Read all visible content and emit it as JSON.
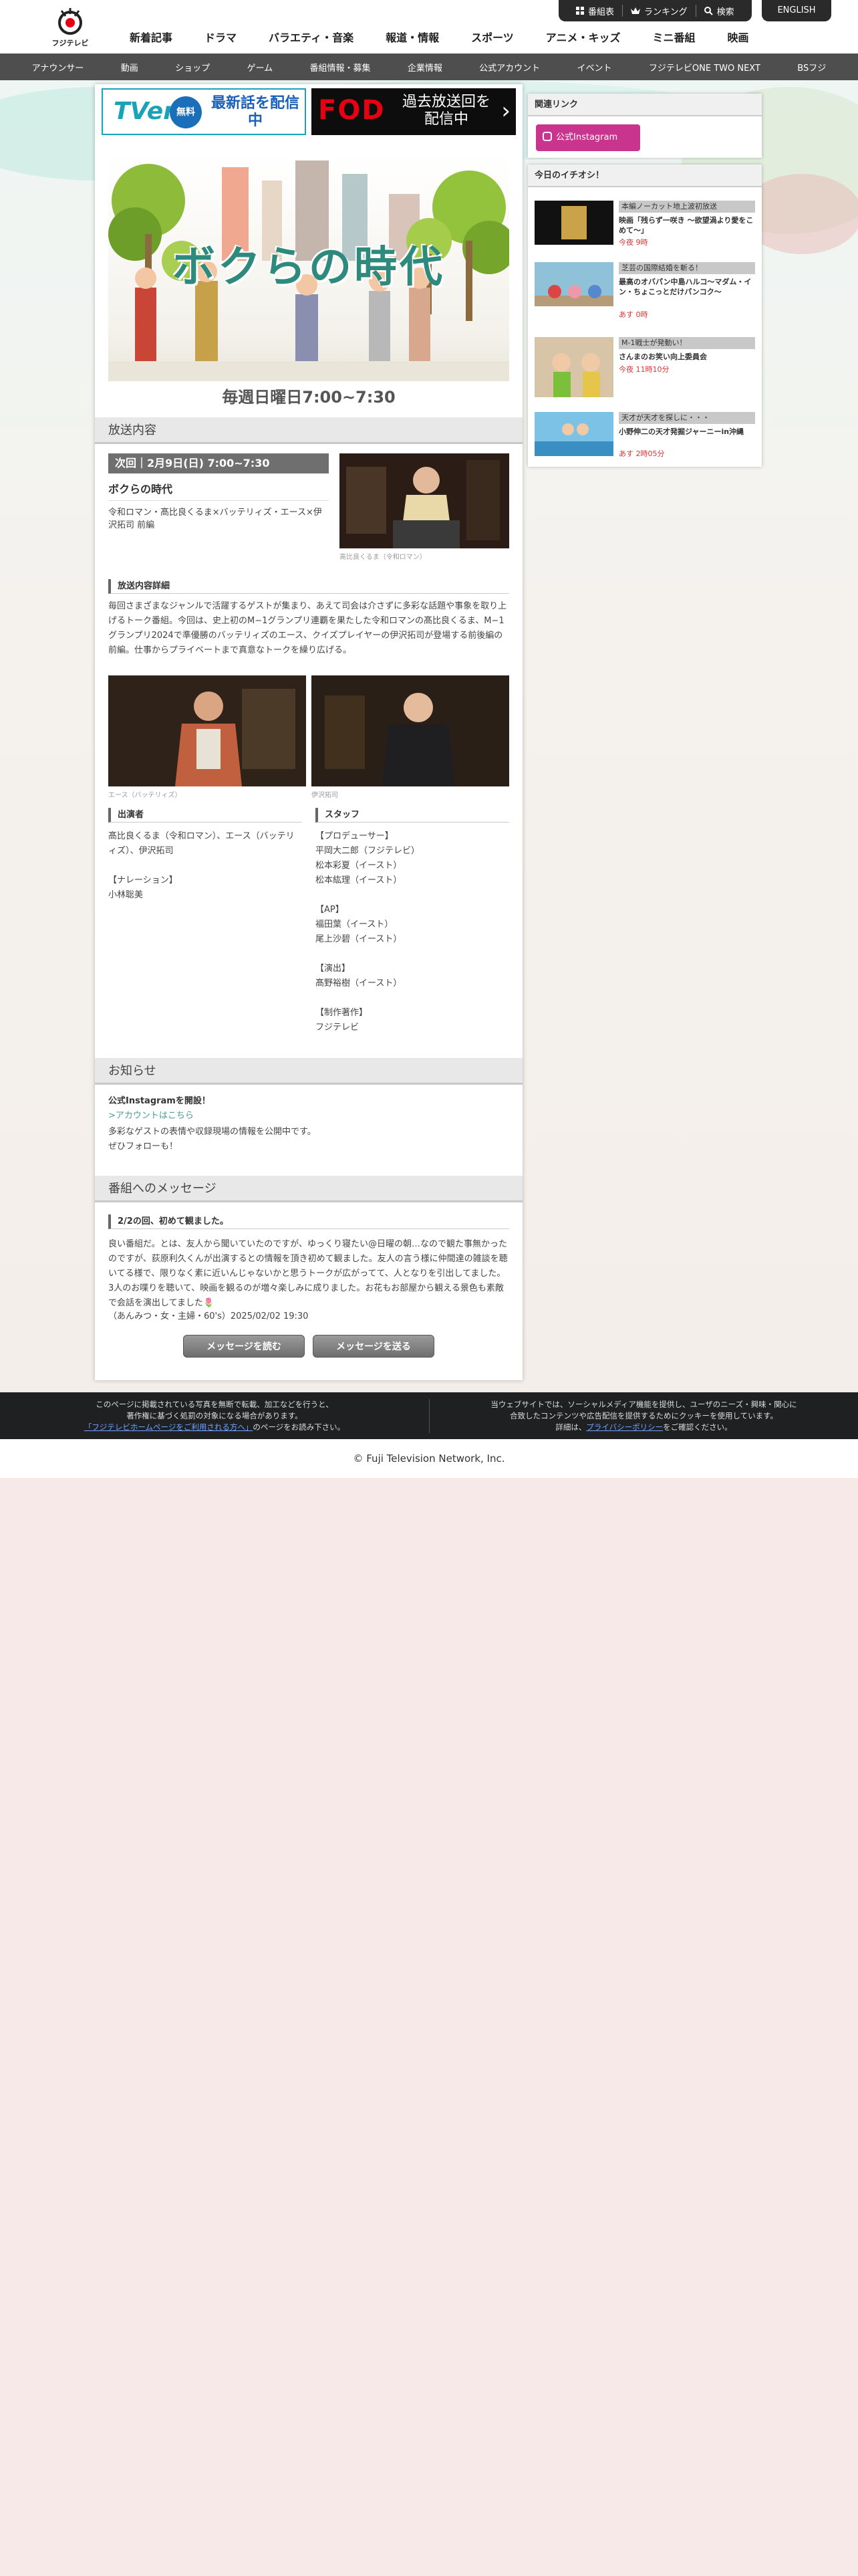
{
  "header": {
    "logo_text": "フジテレビ",
    "util": {
      "schedule": "番組表",
      "ranking": "ランキング",
      "search": "検索"
    },
    "english": "ENGLISH",
    "gnav": [
      "新着記事",
      "ドラマ",
      "バラエティ・音楽",
      "報道・情報",
      "スポーツ",
      "アニメ・キッズ",
      "ミニ番組",
      "映画"
    ],
    "subnav": [
      "アナウンサー",
      "動画",
      "ショップ",
      "ゲーム",
      "番組情報・募集",
      "企業情報",
      "公式アカウント",
      "イベント",
      "フジテレビONE TWO NEXT",
      "BSフジ"
    ]
  },
  "banners": {
    "tver_logo": "TVer",
    "tver_free": "無料",
    "tver_msg": "最新話を配信中",
    "fod_logo": "FOD",
    "fod_msg": "過去放送回を配信中",
    "fod_arrow": "›"
  },
  "program": {
    "logo_title": "ボクらの時代",
    "airtime": "毎週日曜日7:00~7:30"
  },
  "sections": {
    "broadcast": "放送内容",
    "news": "お知らせ",
    "message": "番組へのメッセージ"
  },
  "episode": {
    "next_badge": "次回｜2月9日(日) 7:00~7:30",
    "title": "ボクらの時代",
    "desc": "令和ロマン・髙比良くるま×バッテリィズ・エース×伊沢拓司 前編",
    "photo1_caption": "髙比良くるま（令和ロマン）",
    "detail_head": "放送内容詳細",
    "detail": "毎回さまざまなジャンルで活躍するゲストが集まり、あえて司会は介さずに多彩な話題や事象を取り上げるトーク番組。今回は、史上初のM−1グランプリ連覇を果たした令和ロマンの髙比良くるま、M−1グランプリ2024で準優勝のバッテリィズのエース、クイズプレイヤーの伊沢拓司が登場する前後編の前編。仕事からプライベートまで真意なトークを繰り広げる。",
    "photo2_caption": "エース（バッテリィズ）",
    "photo3_caption": "伊沢拓司",
    "cast_head": "出演者",
    "cast": "髙比良くるま（令和ロマン）、エース（バッテリィズ）、伊沢拓司\n\n【ナレーション】\n小林聡美",
    "staff_head": "スタッフ",
    "staff": "【プロデューサー】\n平岡大二郎（フジテレビ）\n松本彩夏（イースト）\n松本紘理（イースト）\n\n【AP】\n福田葉（イースト）\n尾上沙碧（イースト）\n\n【演出】\n髙野裕樹（イースト）\n\n【制作著作】\nフジテレビ"
  },
  "news": {
    "title": "公式Instagramを開設！",
    "link": ">アカウントはこちら",
    "body": "多彩なゲストの表情や収録現場の情報を公開中です。\nぜひフォローも！"
  },
  "message": {
    "head": "2/2の回、初めて観ました。",
    "body": "良い番組だ。とは、友人から聞いていたのですが、ゆっくり寝たい@日曜の朝…なので観た事無かったのですが、荻原利久くんが出演するとの情報を頂き初めて観ました。友人の言う様に仲間達の雑談を聴いてる様で、限りなく素に近いんじゃないかと思うトークが広がってて、人となりを引出してました。3人のお喋りを聴いて、映画を観るのが増々楽しみに成りました。お花もお部屋から観える景色も素敵で会話を演出してました🌷",
    "author": "（あんみつ・女・主婦・60's）2025/02/02 19:30",
    "btn_read": "メッセージを読む",
    "btn_send": "メッセージを送る"
  },
  "side": {
    "related_head": "関連リンク",
    "insta_btn": "公式Instagram",
    "pick_head": "今日のイチオシ！",
    "picks": [
      {
        "tag": "本編ノーカット地上波初放送",
        "title": "映画「残らず一咲き 〜欲望渦より愛をこめて〜」",
        "time": "今夜 9時"
      },
      {
        "tag": "芝芸の国際結婚を斬る！",
        "title": "最高のオバパン中島ハルコ〜マダム・イン・ちょこっとだけパンコク〜",
        "time": "あす 0時"
      },
      {
        "tag": "M-1戦士が発動い！",
        "title": "さんまのお笑い向上委員会",
        "time": "今夜 11時10分"
      },
      {
        "tag": "天才が天才を探しに・・・",
        "title": "小野伸二の天才発掘ジャーニーin沖縄",
        "time": "あす 2時05分"
      }
    ]
  },
  "footer": {
    "left_1": "このページに掲載されている写真を無断で転載、加工などを行うと、",
    "left_2": "著作権に基づく処罰の対象になる場合があります。",
    "left_link": "「フジテレビホームページをご利用される方へ」",
    "left_3": "のページをお読み下さい。",
    "right_1": "当ウェブサイトでは、ソーシャルメディア機能を提供し、ユーザのニーズ・興味・関心に",
    "right_2": "合致したコンテンツや広告配信を提供するためにクッキーを使用しています。",
    "right_3a": "詳細は、",
    "right_link": "プライバシーポリシー",
    "right_3b": "をご確認ください。",
    "copyright": "© Fuji Television Network, Inc."
  }
}
